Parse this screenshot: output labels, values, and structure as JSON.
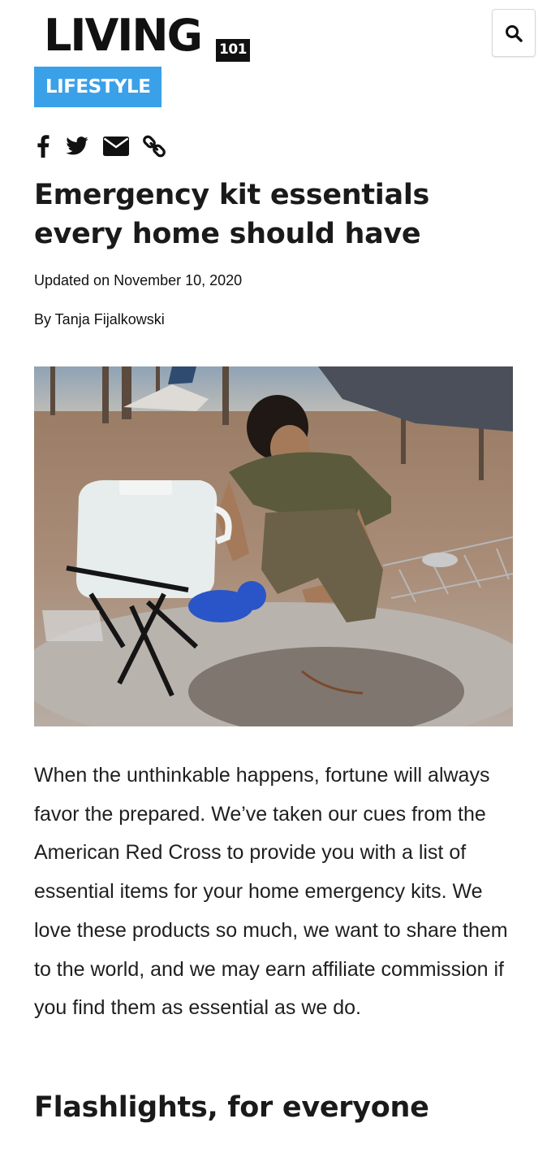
{
  "header": {
    "logo_word": "LIVING",
    "logo_number": "101",
    "search_icon": "search-icon"
  },
  "category": {
    "label": "LIFESTYLE",
    "color": "#3aa0e8"
  },
  "share": {
    "icons": [
      "facebook-icon",
      "twitter-icon",
      "email-icon",
      "link-icon"
    ]
  },
  "article": {
    "title": "Emergency kit essentials every home should have",
    "updated": "Updated on November 10, 2020",
    "byline": "By Tanja Fijalkowski",
    "intro": "When the unthinkable happens, fortune will always favor the prepared. We’ve taken our cues from the American Red Cross to provide you with a list of essential items for your home emergency kits. We love these products so much, we want to share them to the world, and we may earn affiliate commission if you find them as essential as we do.",
    "section_heading": "Flashlights, for everyone"
  }
}
